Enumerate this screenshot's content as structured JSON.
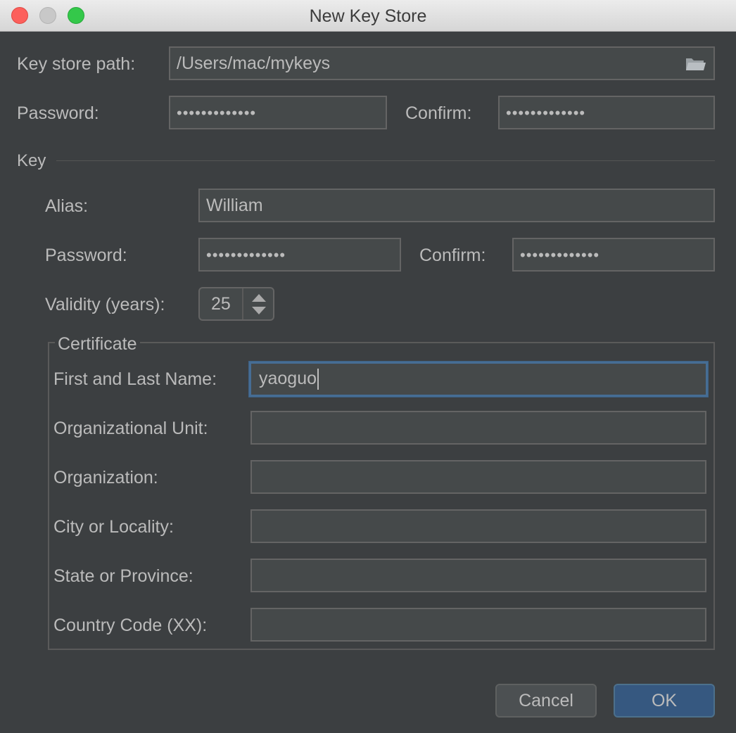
{
  "window": {
    "title": "New Key Store"
  },
  "keystore": {
    "path_label": "Key store path:",
    "path_value": "/Users/mac/mykeys",
    "password_label": "Password:",
    "password_value": "•••••••••••••",
    "confirm_label": "Confirm:",
    "confirm_value": "•••••••••••••"
  },
  "key": {
    "section_label": "Key",
    "alias_label": "Alias:",
    "alias_value": "William",
    "password_label": "Password:",
    "password_value": "•••••••••••••",
    "confirm_label": "Confirm:",
    "confirm_value": "•••••••••••••",
    "validity_label": "Validity (years):",
    "validity_value": "25"
  },
  "certificate": {
    "title": "Certificate",
    "fields": [
      {
        "label": "First and Last Name:",
        "value": "yaoguo"
      },
      {
        "label": "Organizational Unit:",
        "value": ""
      },
      {
        "label": "Organization:",
        "value": ""
      },
      {
        "label": "City or Locality:",
        "value": ""
      },
      {
        "label": "State or Province:",
        "value": ""
      },
      {
        "label": "Country Code (XX):",
        "value": ""
      }
    ]
  },
  "buttons": {
    "cancel": "Cancel",
    "ok": "OK"
  },
  "colors": {
    "background": "#3c3f41",
    "field": "#45494a",
    "focus_border": "#466d94",
    "ok_button": "#365880"
  },
  "icons": {
    "browse": "folder-icon"
  }
}
